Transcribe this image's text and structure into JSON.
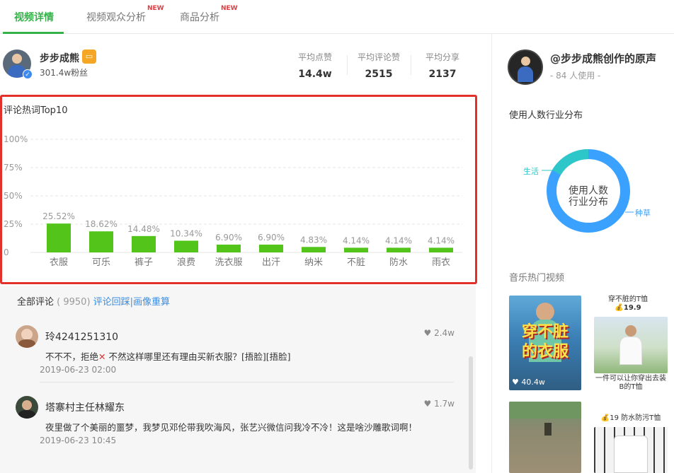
{
  "tabs": [
    {
      "label": "视频详情",
      "active": true,
      "new": ""
    },
    {
      "label": "视频观众分析",
      "active": false,
      "new": "NEW"
    },
    {
      "label": "商品分析",
      "active": false,
      "new": "NEW"
    }
  ],
  "author": {
    "name": "步步成熊",
    "fans": "301.4w粉丝"
  },
  "stats": [
    {
      "label": "平均点赞",
      "value": "14.4w"
    },
    {
      "label": "平均评论赞",
      "value": "2515"
    },
    {
      "label": "平均分享",
      "value": "2137"
    }
  ],
  "chart_data": {
    "type": "bar",
    "title": "评论热词Top10",
    "categories": [
      "衣服",
      "可乐",
      "裤子",
      "浪费",
      "洗衣服",
      "出汗",
      "纳米",
      "不脏",
      "防水",
      "雨衣"
    ],
    "values": [
      25.52,
      18.62,
      14.48,
      10.34,
      6.9,
      6.9,
      4.83,
      4.14,
      4.14,
      4.14
    ],
    "value_labels": [
      "25.52%",
      "18.62%",
      "14.48%",
      "10.34%",
      "6.90%",
      "6.90%",
      "4.83%",
      "4.14%",
      "4.14%",
      "4.14%"
    ],
    "yticks": [
      "100%",
      "75%",
      "50%",
      "25%",
      "0"
    ],
    "ylim": [
      0,
      100
    ],
    "bar_color": "#52c41a",
    "grid": true
  },
  "comments": {
    "label": "全部评论",
    "count": "( 9950)",
    "link": "评论回踩|画像重算",
    "items": [
      {
        "user": "玲4241251310",
        "likes": "2.4w",
        "text_before": "不不不，拒绝",
        "mark": "✕",
        "text_after": " 不然这样哪里还有理由买新衣服？[捂脸][捂脸]",
        "time": "2019-06-23 02:00"
      },
      {
        "user": "塔寨村主任林耀东",
        "likes": "1.7w",
        "text_before": "夜里做了个美丽的噩梦，我梦见邓伦带我吹海风，张艺兴微信问我冷不冷！这是啥沙雕歌词啊！",
        "mark": "",
        "text_after": "",
        "time": "2019-06-23 10:45"
      }
    ]
  },
  "music": {
    "title": "@步步成熊创作的原声",
    "users": "- 84 人使用 -"
  },
  "industry": {
    "title": "使用人数行业分布",
    "center_line1": "使用人数",
    "center_line2": "行业分布",
    "segments": [
      {
        "name": "生活",
        "fraction": 0.2,
        "color": "#2ec7c9"
      },
      {
        "name": "种草",
        "fraction": 0.8,
        "color": "#3aa1ff"
      }
    ]
  },
  "hot_videos": {
    "title": "音乐热门视频",
    "items": [
      {
        "overlay_line1": "穿不脏",
        "overlay_line2": "的衣服",
        "likes": "40.4w"
      }
    ],
    "products": [
      {
        "name": "穿不脏的T恤",
        "price": "19.9",
        "note": "一件可以让你穿出去装B的T恤"
      },
      {
        "name": "19 防水防污T恤"
      }
    ]
  }
}
